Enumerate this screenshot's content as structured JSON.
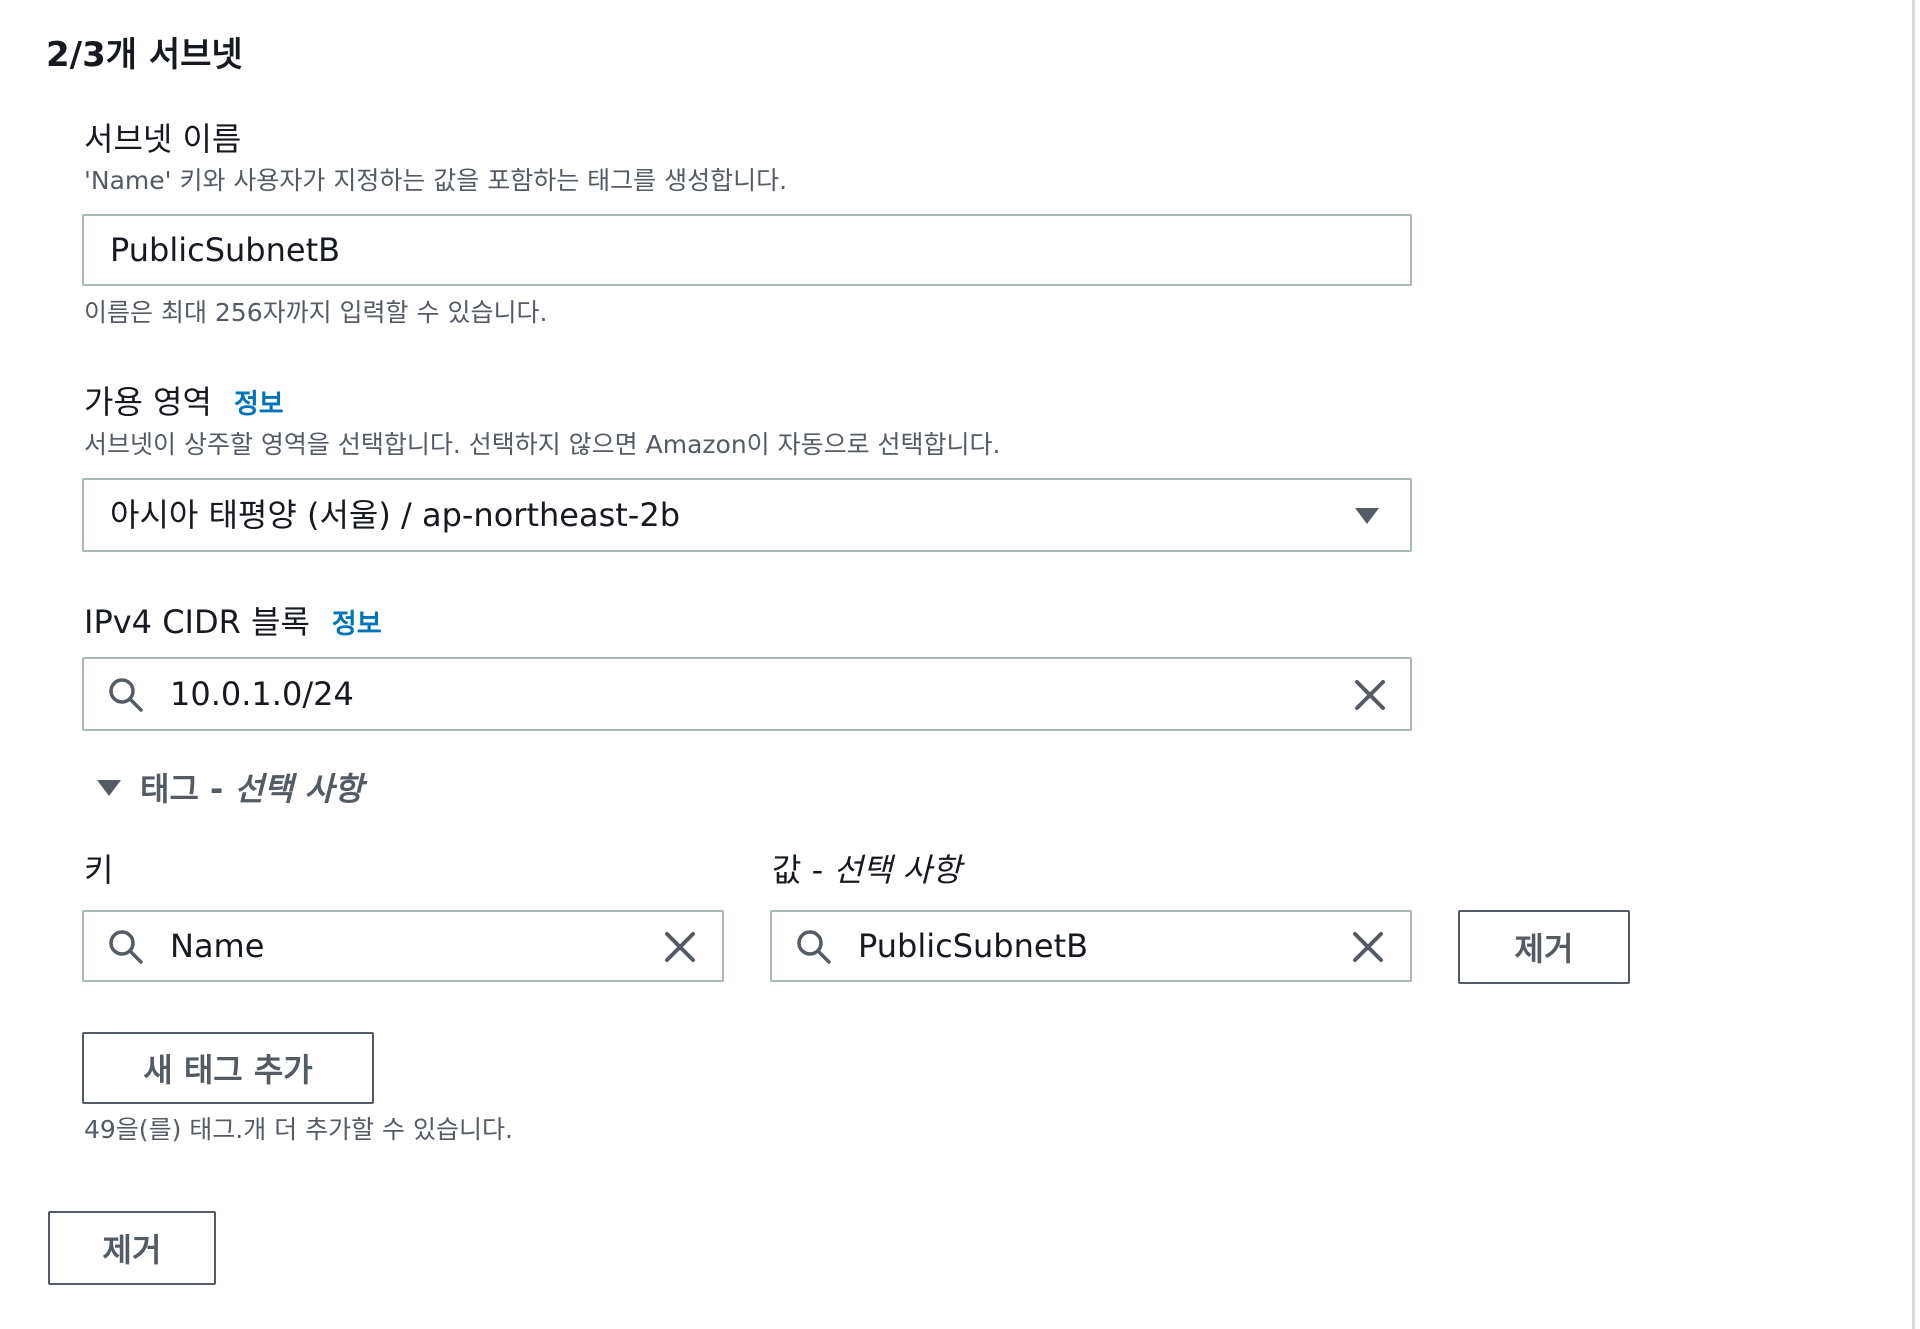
{
  "section": {
    "title": "2/3개 서브넷"
  },
  "subnet_name": {
    "label": "서브넷 이름",
    "description": "'Name' 키와 사용자가 지정하는 값을 포함하는 태그를 생성합니다.",
    "value": "PublicSubnetB",
    "constraint": "이름은 최대 256자까지 입력할 수 있습니다."
  },
  "availability_zone": {
    "label": "가용 영역",
    "info_link": "정보",
    "description": "서브넷이 상주할 영역을 선택합니다. 선택하지 않으면 Amazon이 자동으로 선택합니다.",
    "selected": "아시아 태평양 (서울) / ap-northeast-2b"
  },
  "cidr": {
    "label": "IPv4 CIDR 블록",
    "info_link": "정보",
    "value": "10.0.1.0/24"
  },
  "tags": {
    "toggle_label": "태그 - ",
    "toggle_optional": "선택 사항",
    "key_label": "키",
    "value_label": "값 - ",
    "value_optional": "선택 사항",
    "key_value": "Name",
    "value_value": "PublicSubnetB",
    "remove_tag_button": "제거",
    "add_tag_button": "새 태그 추가",
    "remaining_note": "49을(를) 태그.개 더 추가할 수 있습니다."
  },
  "remove_subnet_button": "제거",
  "colors": {
    "link": "#0073bb",
    "border": "#aab7b8",
    "button_border": "#545b64",
    "text": "#16191f",
    "secondary_text": "#545b64"
  },
  "icons": [
    "search-icon",
    "clear-icon",
    "caret-down-icon"
  ]
}
